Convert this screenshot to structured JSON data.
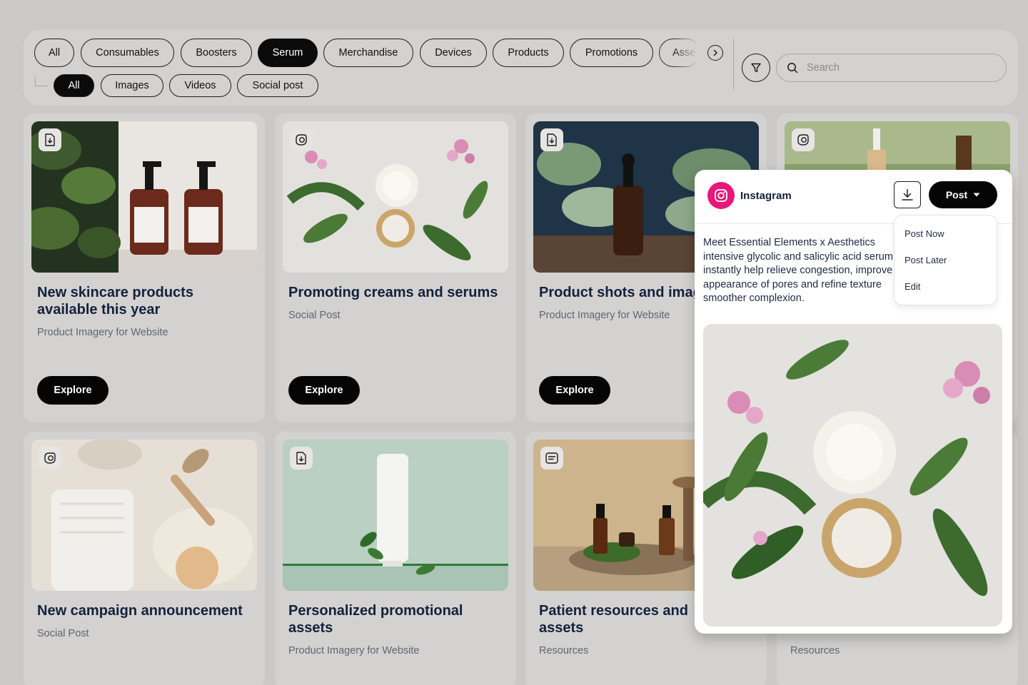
{
  "filters": {
    "categories": [
      "All",
      "Consumables",
      "Boosters",
      "Serum",
      "Merchandise",
      "Devices",
      "Products",
      "Promotions",
      "Asse"
    ],
    "active_category": "Serum",
    "types": [
      "All",
      "Images",
      "Videos",
      "Social post"
    ],
    "active_type": "All",
    "search_placeholder": "Search"
  },
  "cards": [
    {
      "title": "New skincare products available this year",
      "subtitle": "Product Imagery for Website",
      "button": "Explore",
      "badge_icon": "download-doc-icon"
    },
    {
      "title": "Promoting creams and serums",
      "subtitle": "Social Post",
      "button": "Explore",
      "badge_icon": "social-icon"
    },
    {
      "title": "Product shots and images",
      "subtitle": "Product Imagery for Website",
      "button": "Explore",
      "badge_icon": "download-doc-icon"
    },
    {
      "title": "",
      "subtitle": "",
      "button": "",
      "badge_icon": "social-icon"
    },
    {
      "title": "New campaign announcement",
      "subtitle": "Social Post",
      "button": "",
      "badge_icon": "social-icon"
    },
    {
      "title": "Personalized promotional assets",
      "subtitle": "Product Imagery for Website",
      "button": "",
      "badge_icon": "download-doc-icon"
    },
    {
      "title": "Patient resources and assets",
      "subtitle": "Resources",
      "button": "",
      "badge_icon": "document-icon"
    },
    {
      "title": "",
      "subtitle": "Resources",
      "button": "",
      "badge_icon": "social-icon"
    }
  ],
  "post_panel": {
    "platform": "Instagram",
    "post_label": "Post",
    "menu": [
      "Post Now",
      "Post Later",
      "Edit"
    ],
    "caption_lines": [
      "Meet Essential Elements x Aesthetics",
      "intensive glycolic and salicylic acid serum",
      "instantly help relieve congestion, improve",
      "appearance of pores and refine texture",
      "smoother complexion."
    ]
  },
  "colors": {
    "background": "#cbc9c8",
    "card": "#d3d2d1",
    "title": "#13213c",
    "accent_dark": "#050505",
    "instagram": "#e8177a"
  }
}
